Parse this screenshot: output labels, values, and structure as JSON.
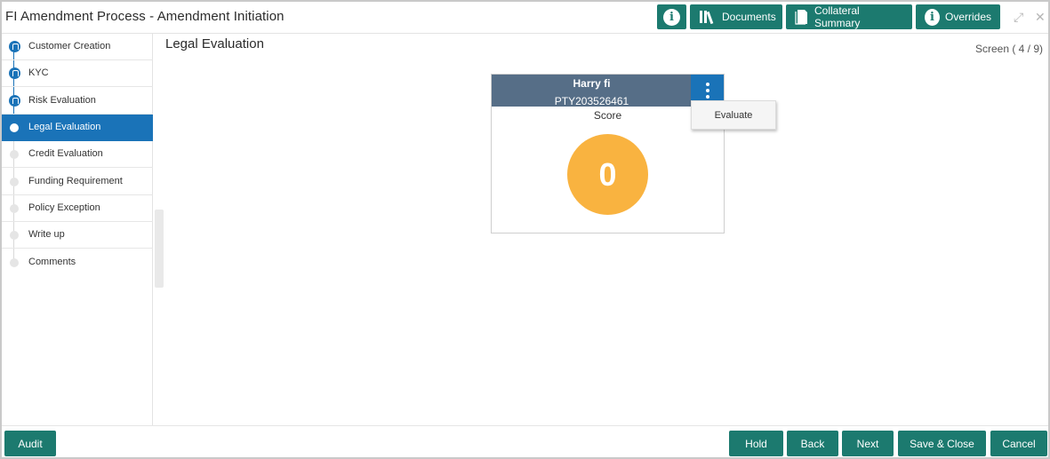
{
  "header": {
    "title": "FI Amendment Process - Amendment Initiation",
    "buttons": {
      "info_icon": "info-icon",
      "documents": "Documents",
      "collateral_summary": "Collateral Summary",
      "overrides": "Overrides"
    },
    "maximize_glyph": "⤢",
    "close_glyph": "✕"
  },
  "sidebar": {
    "steps": [
      {
        "label": "Customer Creation",
        "state": "done"
      },
      {
        "label": "KYC",
        "state": "done"
      },
      {
        "label": "Risk Evaluation",
        "state": "done"
      },
      {
        "label": "Legal Evaluation",
        "state": "active"
      },
      {
        "label": "Credit Evaluation",
        "state": "pending"
      },
      {
        "label": "Funding Requirement",
        "state": "pending"
      },
      {
        "label": "Policy Exception",
        "state": "pending"
      },
      {
        "label": "Write up",
        "state": "pending"
      },
      {
        "label": "Comments",
        "state": "pending"
      }
    ]
  },
  "main": {
    "section_title": "Legal Evaluation",
    "screen_indicator": "Screen ( 4 / 9)",
    "card": {
      "name": "Harry fi",
      "party_id": "PTY203526461",
      "score_label": "Score",
      "score_value": "0"
    },
    "menu": {
      "evaluate": "Evaluate"
    }
  },
  "footer": {
    "audit": "Audit",
    "hold": "Hold",
    "back": "Back",
    "next": "Next",
    "save_close": "Save & Close",
    "cancel": "Cancel"
  },
  "colors": {
    "primary_button": "#1c7a6f",
    "active_step": "#1a73b8",
    "card_header": "#566e87",
    "score_circle": "#f9b340"
  }
}
